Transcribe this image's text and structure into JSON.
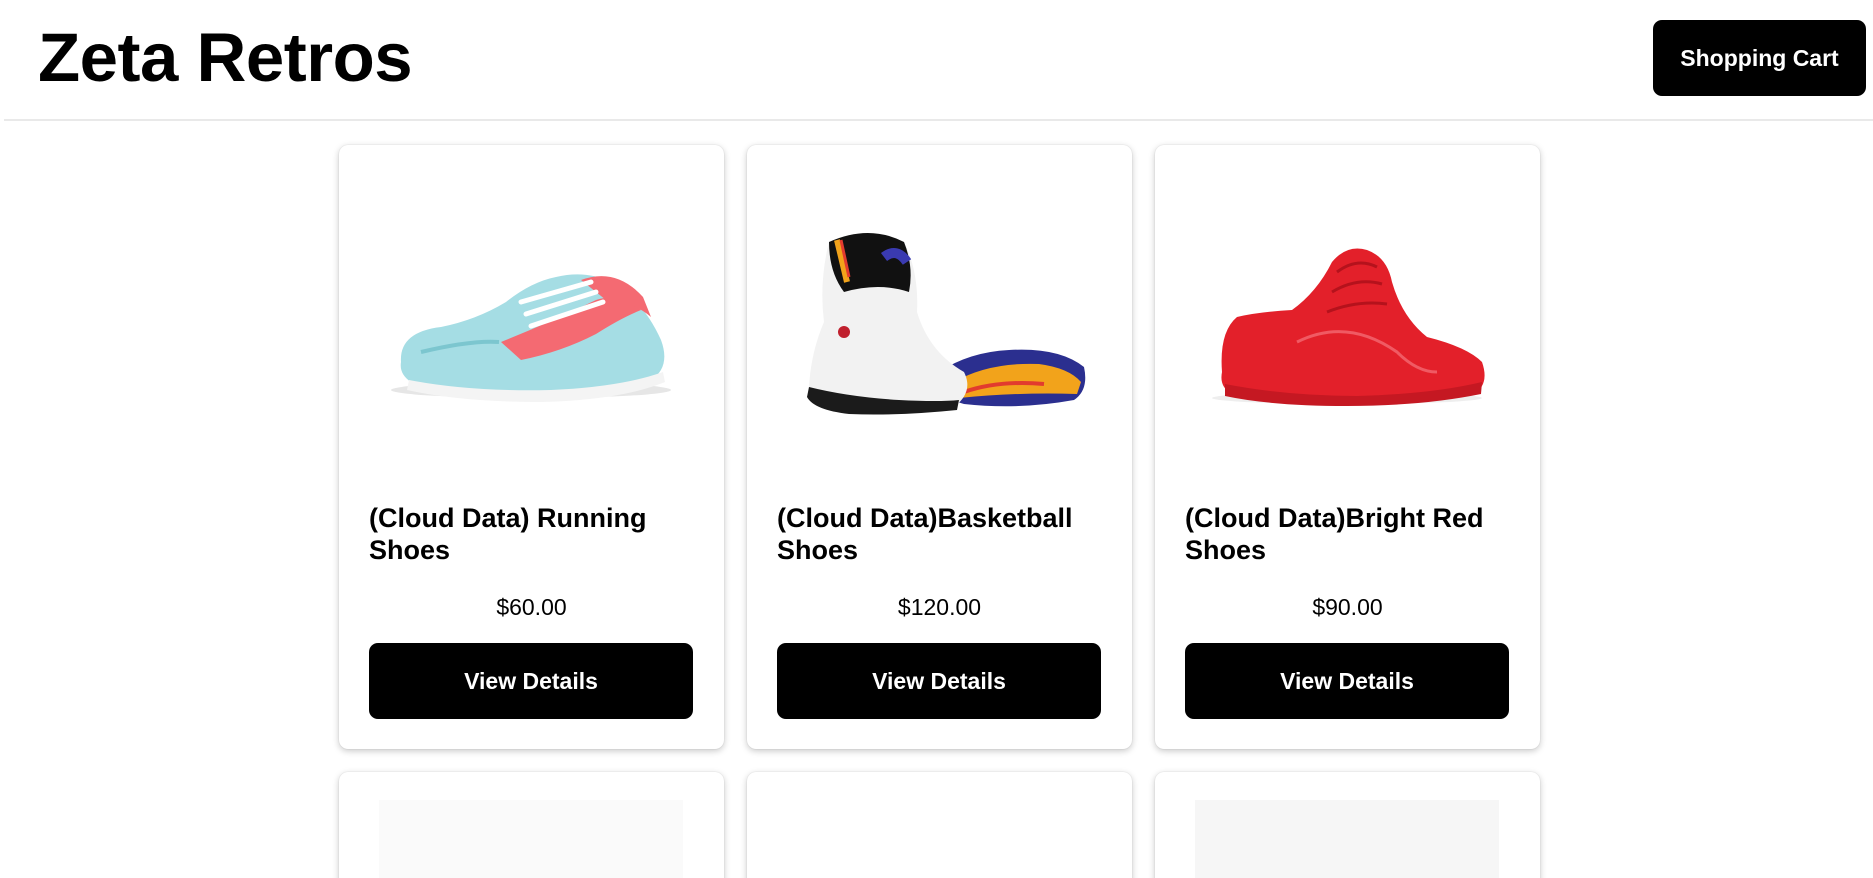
{
  "header": {
    "brand": "Zeta Retros",
    "cart_label": "Shopping Cart"
  },
  "products": [
    {
      "name": "(Cloud Data) Running Shoes",
      "price": "$60.00",
      "button_label": "View Details",
      "image": "running-shoe-image"
    },
    {
      "name": "(Cloud Data)Basketball Shoes",
      "price": "$120.00",
      "button_label": "View Details",
      "image": "basketball-shoes-image"
    },
    {
      "name": "(Cloud Data)Bright Red Shoes",
      "price": "$90.00",
      "button_label": "View Details",
      "image": "red-shoe-image"
    }
  ],
  "colors": {
    "button_bg": "#000000",
    "button_text": "#ffffff",
    "page_bg": "#ffffff"
  }
}
